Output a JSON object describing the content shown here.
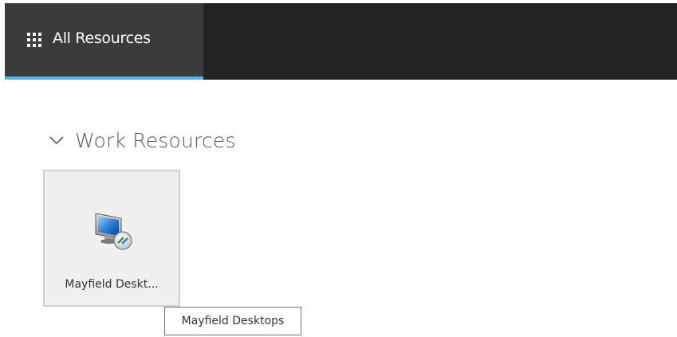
{
  "header": {
    "tab_all_resources": "All Resources",
    "grid_icon": "apps-grid-icon",
    "accent_color": "#56b4f0"
  },
  "section": {
    "title": "Work Resources",
    "chevron_icon": "chevron-down-icon"
  },
  "resources": [
    {
      "label": "Mayfield Deskt...",
      "icon": "remote-desktop-icon",
      "tooltip": "Mayfield Desktops"
    }
  ]
}
